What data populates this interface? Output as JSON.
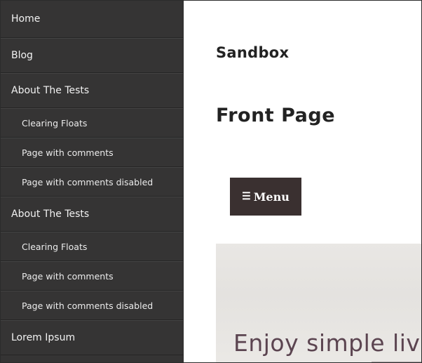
{
  "sidebar": {
    "items": [
      {
        "label": "Home",
        "level": "top"
      },
      {
        "label": "Blog",
        "level": "top"
      },
      {
        "label": "About The Tests",
        "level": "top"
      },
      {
        "label": "Clearing Floats",
        "level": "sub"
      },
      {
        "label": "Page with comments",
        "level": "sub"
      },
      {
        "label": "Page with comments disabled",
        "level": "sub"
      },
      {
        "label": "About The Tests",
        "level": "top"
      },
      {
        "label": "Clearing Floats",
        "level": "sub"
      },
      {
        "label": "Page with comments",
        "level": "sub"
      },
      {
        "label": "Page with comments disabled",
        "level": "sub"
      },
      {
        "label": "Lorem Ipsum",
        "level": "top"
      }
    ]
  },
  "header": {
    "site_title": "Sandbox"
  },
  "main": {
    "page_title": "Front Page",
    "menu_button": {
      "icon": "hamburger-icon",
      "label": "Menu"
    },
    "hero": {
      "headline": "Enjoy simple living"
    }
  },
  "colors": {
    "sidebar_bg": "#353434",
    "menu_button_bg": "#3a3030",
    "hero_text": "#5b4450"
  }
}
